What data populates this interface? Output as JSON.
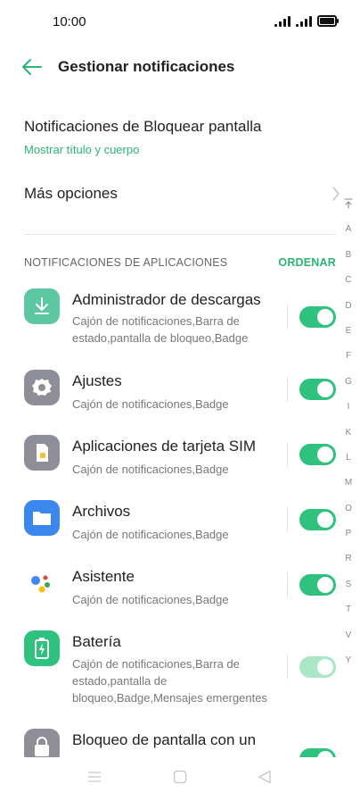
{
  "status": {
    "time": "10:00"
  },
  "header": {
    "title": "Gestionar notificaciones"
  },
  "lock_screen": {
    "title": "Notificaciones de Bloquear pantalla",
    "subtitle": "Mostrar título y cuerpo"
  },
  "more_options": {
    "label": "Más opciones"
  },
  "section": {
    "title": "NOTIFICACIONES DE APLICACIONES",
    "action": "ORDENAR"
  },
  "alphabet": [
    "A",
    "B",
    "C",
    "D",
    "E",
    "F",
    "G",
    "I",
    "K",
    "L",
    "M",
    "O",
    "P",
    "R",
    "S",
    "T",
    "V",
    "Y"
  ],
  "apps": [
    {
      "name": "Administrador de descargas",
      "desc": "Cajón de notificaciones,Barra de estado,pantalla de bloqueo,Badge",
      "icon": "download-icon",
      "color": "#5cc7a0",
      "enabled": true
    },
    {
      "name": "Ajustes",
      "desc": "Cajón de notificaciones,Badge",
      "icon": "settings-gear-icon",
      "color": "#8e8e99",
      "enabled": true
    },
    {
      "name": "Aplicaciones de tarjeta SIM",
      "desc": "Cajón de notificaciones,Badge",
      "icon": "sim-card-icon",
      "color": "#8e8e99",
      "enabled": true
    },
    {
      "name": "Archivos",
      "desc": "Cajón de notificaciones,Badge",
      "icon": "folder-icon",
      "color": "#3b87f0",
      "enabled": true
    },
    {
      "name": "Asistente",
      "desc": "Cajón de notificaciones,Badge",
      "icon": "assistant-icon",
      "color": "#ffffff",
      "enabled": true
    },
    {
      "name": "Batería",
      "desc": "Cajón de notificaciones,Barra de estado,pantalla de bloqueo,Badge,Mensajes emergentes",
      "icon": "battery-icon",
      "color": "#2ec27e",
      "enabled": true,
      "dimmed": true
    },
    {
      "name": "Bloqueo de pantalla con un",
      "icon": "lock-icon",
      "color": "#8e8e99",
      "enabled": true
    }
  ]
}
